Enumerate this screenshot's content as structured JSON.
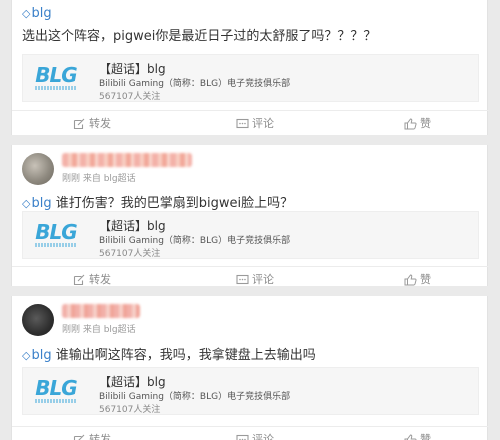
{
  "topic_symbol": "◇",
  "posts": [
    {
      "topic": "blg",
      "text": "选出这个阵容，pigwei你是最近日子过的太舒服了吗？？？？",
      "card": {
        "logo_text": "BLG",
        "title": "【超话】blg",
        "desc": "Bilibili Gaming（简称：BLG）电子竞技俱乐部",
        "fans": "567107人关注"
      }
    },
    {
      "author_meta": "刚刚 来自 blg超话",
      "topic": "blg",
      "text": "谁打伤害？我的巴掌扇到bigwei脸上吗？",
      "card": {
        "logo_text": "BLG",
        "title": "【超话】blg",
        "desc": "Bilibili Gaming（简称：BLG）电子竞技俱乐部",
        "fans": "567107人关注"
      }
    },
    {
      "author_meta": "刚刚 来自 blg超话",
      "topic": "blg",
      "text": "谁输出啊这阵容，我吗，我拿键盘上去输出吗",
      "card": {
        "logo_text": "BLG",
        "title": "【超话】blg",
        "desc": "Bilibili Gaming（简称：BLG）电子竞技俱乐部",
        "fans": "567107人关注"
      }
    }
  ],
  "actions": {
    "repost": "转发",
    "comment": "评论",
    "like": "赞"
  },
  "colors": {
    "topic_link": "#3a80c9",
    "logo": "#3aa6d8",
    "page_bg": "#eaeaea"
  }
}
